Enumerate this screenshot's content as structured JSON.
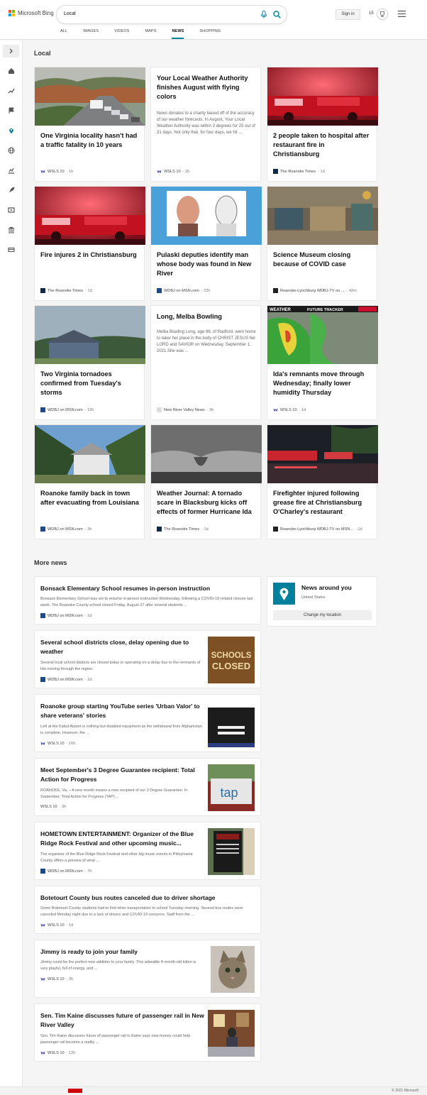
{
  "header": {
    "logo_text": "Microsoft Bing",
    "search_value": "Local",
    "signin_label": "Sign in",
    "rewards_count": "15",
    "nav": [
      {
        "label": "ALL"
      },
      {
        "label": "IMAGES"
      },
      {
        "label": "VIDEOS"
      },
      {
        "label": "MAPS"
      },
      {
        "label": "NEWS"
      },
      {
        "label": "SHOPPING"
      }
    ]
  },
  "colors": {
    "accent": "#00809d",
    "logo_red": "#f25022",
    "logo_green": "#7fba00",
    "logo_blue": "#00a4ef",
    "logo_yellow": "#ffb900"
  },
  "local": {
    "title": "Local",
    "cards": [
      {
        "title": "One Virginia locality hasn't had a traffic fatality in 10 years",
        "source": "WSLS 10",
        "time": "· 1h",
        "image": "highway-traffic"
      },
      {
        "title": "Your Local Weather Authority finishes August with flying colors",
        "snippet": "News donates to a charity based off of the accuracy of our weather forecasts. In August, Your Local Weather Authority was within 3 degrees for 25 out of 31 days. Not only that, for four days, we hit ...",
        "source": "WSLS 10",
        "time": "· 2h"
      },
      {
        "title": "2 people taken to hospital after restaurant fire in Christiansburg",
        "source": "The Roanoke Times",
        "time": "· 1d",
        "image": "fire-truck"
      },
      {
        "title": "Fire injures 2 in Christiansburg",
        "source": "The Roanoke Times",
        "time": "· 1d",
        "image": "fire-truck"
      },
      {
        "title": "Pulaski deputies identify man whose body was found in New River",
        "source": "WDBJ on MSN.com",
        "time": "· 22h",
        "image": "photo-and-sketch"
      },
      {
        "title": "Science Museum closing because of COVID case",
        "source": "Roanoke-Lynchburg WDBJ-TV on ...",
        "time": "· 42m",
        "image": "museum-interior"
      },
      {
        "title": "Two Virginia tornadoes confirmed from Tuesday's storms",
        "source": "WDBJ on MSN.com",
        "time": "· 19h",
        "image": "damaged-house"
      },
      {
        "title": "Long, Melba Bowling",
        "snippet": "Melba Bowling Long, age 88, of Radford, went home to taker her place in the body of CHRIST JESUS her LORD and SAVIOR on Wednesday, September 1, 2021.She was ...",
        "source": "New River Valley News",
        "time": "· 3h"
      },
      {
        "title": "Ida's remnants move through Wednesday; finally lower humidity Thursday",
        "source": "WSLS 10",
        "time": "· 1d",
        "image": "weather-radar",
        "image_text_1": "WEATHER",
        "image_text_2": "FUTURE TRACKER"
      },
      {
        "title": "Roanoke family back in town after evacuating from Louisiana",
        "source": "WDBJ on MSN.com",
        "time": "· 3h",
        "image": "storm-damage"
      },
      {
        "title": "Weather Journal: A tornado scare in Blacksburg kicks off effects of former Hurricane Ida",
        "source": "The Roanoke Times",
        "time": "· 1d",
        "image": "storm-cloud"
      },
      {
        "title": "Firefighter injured following grease fire at Christiansburg O'Charley's restaurant",
        "source": "Roanoke-Lynchburg WDBJ-TV on MSN...",
        "time": "· 1d",
        "image": "night-fire-scene"
      }
    ]
  },
  "more_news": {
    "title": "More news",
    "items": [
      {
        "title": "Bonsack Elementary School resumes in-person instruction",
        "snippet": "Bonsack Elementary School was set to resume in-person instruction Wednesday, following a COVID-19 related closure last week. The Roanoke County school closed Friday, August 27 after several students ...",
        "source": "WDBJ on MSN.com",
        "time": "· 1d"
      },
      {
        "title": "Several school districts close, delay opening due to weather",
        "snippet": "Several local school districts are closed today or operating on a delay due to the remnants of Ida moving through the region.",
        "source": "WDBJ on MSN.com",
        "time": "· 1d",
        "thumb_line_1": "SCHOOLS",
        "thumb_line_2": "CLOSED"
      },
      {
        "title": "Roanoke group starting YouTube series 'Urban Valor' to share veterans' stories",
        "snippet": "Left at the Kabul Airport is nothing but disabled equipment as the withdrawal from Afghanistan is complete. However, the ...",
        "source": "WSLS 10",
        "time": "· 16h"
      },
      {
        "title": "Meet September's 3 Degree Guarantee recipient: Total Action for Progress",
        "snippet": "ROANOKE, Va. – A new month means a new recipient of our 3 Degree Guarantee. In September, Total Action for Progress (TAP) ...",
        "source": "WSLS 10",
        "time": "· 3h",
        "thumb_text": "tap"
      },
      {
        "title": "HOMETOWN ENTERTAINMENT: Organizer of the Blue Ridge Rock Festival and other upcoming music...",
        "snippet": "The organizer of the Blue Ridge Rock Festival and other big music events in Pittsylvania County offers a preview of what ...",
        "source": "WDBJ on MSN.com",
        "time": "· 7h"
      },
      {
        "title": "Botetourt County bus routes canceled due to driver shortage",
        "snippet": "Some Botetourt County students had to find other transportation to school Tuesday morning. Several bus routes were canceled Monday night due to a lack of drivers and COVID-19 concerns. Staff from the ...",
        "source": "WSLS 10",
        "time": "· 1d"
      },
      {
        "title": "Jimmy is ready to join your family",
        "snippet": "Jimmy could be the perfect new addition to your family. This adorable 4-month-old kitten is very playful, full of energy, and ...",
        "source": "WSLS 10",
        "time": "· 3h"
      },
      {
        "title": "Sen. Tim Kaine discusses future of passenger rail in New River Valley",
        "snippet": "Sen. Tim Kaine discusses future of passenger rail in Kaine says new money could help passenger rail become a reality ...",
        "source": "WSLS 10",
        "time": "· 12h"
      }
    ]
  },
  "around": {
    "title": "News around you",
    "location": "United States",
    "button": "Change my location"
  },
  "footer": {
    "copyright": "© 2021 Microsoft"
  }
}
